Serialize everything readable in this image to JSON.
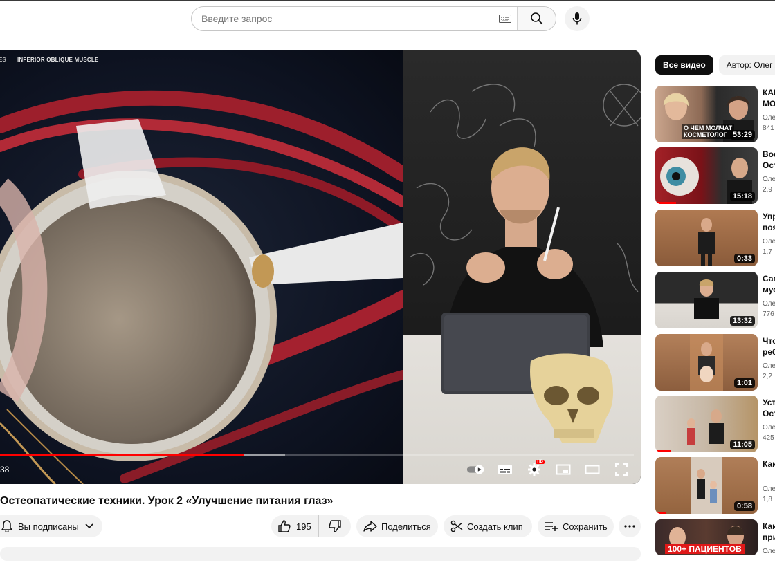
{
  "search": {
    "placeholder": "Введите запрос"
  },
  "icons": {
    "keyboard": "keyboard-icon",
    "search": "search-icon",
    "mic": "mic-icon"
  },
  "player": {
    "scene_label": "INFERIOR OBLIQUE MUSCLE",
    "scene_label_cut": "ES",
    "time": "38",
    "progress_played": 0.385,
    "progress_buffered": 0.45,
    "hd_badge": "HD"
  },
  "video": {
    "title": "Остеопатические техники. Урок 2 «Улучшение питания глаз»",
    "subscribe_label": "Вы подписаны",
    "like_count": "195",
    "share_label": "Поделиться",
    "clip_label": "Создать клип",
    "save_label": "Сохранить"
  },
  "sidebar": {
    "chips": [
      "Все видео",
      "Автор: Олег А"
    ],
    "recommendations": [
      {
        "title": "КАН\nМО",
        "channel": "Оле",
        "views": "841",
        "duration": "53:29",
        "overlay": "О ЧЕМ МОЛЧАТ\nКОСМЕТОЛОГ",
        "progress": 0.0
      },
      {
        "title": "Вос\nОст",
        "channel": "Оле",
        "views": "2,9",
        "duration": "15:18",
        "overlay": "",
        "progress": 0.2
      },
      {
        "title": "Упр\nпоя",
        "channel": "Оле",
        "views": "1,7",
        "duration": "0:33",
        "overlay": "",
        "progress": 0.0
      },
      {
        "title": "Сам\nмус",
        "channel": "Оле",
        "views": "776",
        "duration": "13:32",
        "overlay": "",
        "progress": 0.0
      },
      {
        "title": "Что\nреб",
        "channel": "Оле",
        "views": "2,2",
        "duration": "1:01",
        "overlay": "",
        "progress": 0.0
      },
      {
        "title": "Уст\nОст",
        "channel": "Оле",
        "views": "425",
        "duration": "11:05",
        "overlay": "",
        "progress": 0.15
      },
      {
        "title": "Как",
        "channel": "Оле",
        "views": "1,8",
        "duration": "0:58",
        "overlay": "",
        "progress": 0.1
      },
      {
        "title": "Как\nпри",
        "channel": "Оле",
        "views": "",
        "duration": "",
        "overlay": "100+ ПАЦИЕНТОВ",
        "progress": 0.0
      }
    ]
  }
}
